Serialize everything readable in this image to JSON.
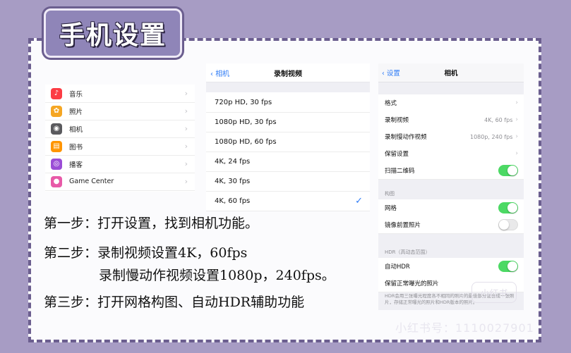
{
  "title": "手机设置",
  "panel1": {
    "items": [
      {
        "icon": "music-icon",
        "label": "音乐",
        "color": "#fc3c44"
      },
      {
        "icon": "photos-icon",
        "label": "照片",
        "color": "#f5a623"
      },
      {
        "icon": "camera-icon",
        "label": "相机",
        "color": "#5a5a5e"
      },
      {
        "icon": "books-icon",
        "label": "图书",
        "color": "#ff9500"
      },
      {
        "icon": "podcasts-icon",
        "label": "播客",
        "color": "#9b4dd6"
      },
      {
        "icon": "game-center-icon",
        "label": "Game Center",
        "color": "#e85aa8"
      }
    ]
  },
  "panel2": {
    "back": "相机",
    "title": "录制视频",
    "options": [
      "720p HD, 30 fps",
      "1080p HD, 30 fps",
      "1080p HD, 60 fps",
      "4K, 24 fps",
      "4K, 30 fps",
      "4K, 60 fps"
    ],
    "selected": "4K, 60 fps"
  },
  "panel3": {
    "back": "设置",
    "title": "相机",
    "rows": {
      "format": "格式",
      "record_video": "录制视频",
      "record_video_value": "4K, 60 fps",
      "record_slomo": "录制慢动作视频",
      "record_slomo_value": "1080p, 240 fps",
      "preserve": "保留设置",
      "qr": "扫描二维码",
      "composition_header": "构图",
      "grid": "网格",
      "mirror": "镜像前置照片",
      "hdr_header": "HDR（高动态范围）",
      "auto_hdr": "自动HDR",
      "keep_normal": "保留正常曝光的照片"
    },
    "toggles": {
      "qr": true,
      "grid": true,
      "mirror": false,
      "auto_hdr": true
    },
    "footnote": "HDR会用三张曝光程度各不相同的照片的最佳部分混合成一张照片，存储正常曝光的照片和HDR版本的照片。"
  },
  "steps": {
    "step1": "第一步：打开设置，找到相机功能。",
    "step2a": "第二步：录制视频设置4K，60fps",
    "step2b": "录制慢动作视频设置1080p，240fps。",
    "step3": "第三步：打开网格构图、自动HDR辅助功能"
  },
  "watermark": {
    "logo": "小红书",
    "text": "小红书号：1110027901"
  }
}
